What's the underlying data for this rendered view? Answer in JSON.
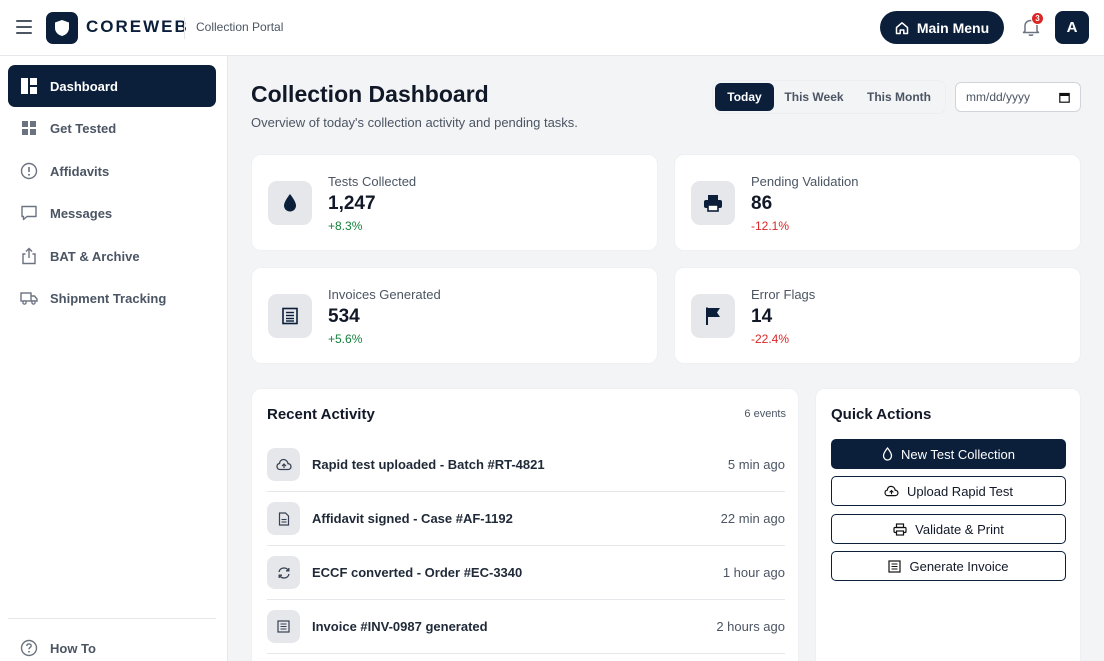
{
  "header": {
    "brand": "COREWEB",
    "subtitle": "Collection Portal",
    "main_menu_label": "Main Menu",
    "notification_count": "3",
    "avatar_initial": "A"
  },
  "sidebar": {
    "items": [
      {
        "label": "Dashboard",
        "icon": "dashboard-icon",
        "active": true
      },
      {
        "label": "Get Tested",
        "icon": "grid-icon"
      },
      {
        "label": "Affidavits",
        "icon": "alert-circle-icon"
      },
      {
        "label": "Messages",
        "icon": "message-icon"
      },
      {
        "label": "BAT & Archive",
        "icon": "share-icon"
      },
      {
        "label": "Shipment Tracking",
        "icon": "truck-icon"
      }
    ],
    "footer_item": {
      "label": "How To",
      "icon": "help-icon"
    }
  },
  "page": {
    "title": "Collection Dashboard",
    "subtitle": "Overview of today's collection activity and pending tasks."
  },
  "filters": {
    "ranges": [
      "Today",
      "This Week",
      "This Month"
    ],
    "active": "Today",
    "date_placeholder": "mm/dd/yyyy"
  },
  "stats": [
    {
      "label": "Tests Collected",
      "value": "1,247",
      "delta": "+8.3%",
      "icon": "drop-icon"
    },
    {
      "label": "Pending Validation",
      "value": "86",
      "delta": "-12.1%",
      "icon": "printer-icon"
    },
    {
      "label": "Invoices Generated",
      "value": "534",
      "delta": "+5.6%",
      "icon": "invoice-icon"
    },
    {
      "label": "Error Flags",
      "value": "14",
      "delta": "-22.4%",
      "icon": "flag-icon"
    }
  ],
  "activity": {
    "title": "Recent Activity",
    "count_label": "6 events",
    "items": [
      {
        "text": "Rapid test uploaded - Batch #RT-4821",
        "time": "5 min ago",
        "icon": "cloud-upload-icon"
      },
      {
        "text": "Affidavit signed - Case #AF-1192",
        "time": "22 min ago",
        "icon": "document-icon"
      },
      {
        "text": "ECCF converted - Order #EC-3340",
        "time": "1 hour ago",
        "icon": "refresh-icon"
      },
      {
        "text": "Invoice #INV-0987 generated",
        "time": "2 hours ago",
        "icon": "invoice-icon"
      }
    ]
  },
  "quick_actions": {
    "title": "Quick Actions",
    "buttons": [
      {
        "label": "New Test Collection",
        "icon": "drop-icon",
        "primary": true
      },
      {
        "label": "Upload Rapid Test",
        "icon": "cloud-upload-icon"
      },
      {
        "label": "Validate & Print",
        "icon": "printer-icon"
      },
      {
        "label": "Generate Invoice",
        "icon": "invoice-icon"
      }
    ]
  },
  "colors": {
    "primary": "#0b1f3a",
    "positive": "#15803d",
    "negative": "#dc2626",
    "background": "#f3f4f6"
  }
}
